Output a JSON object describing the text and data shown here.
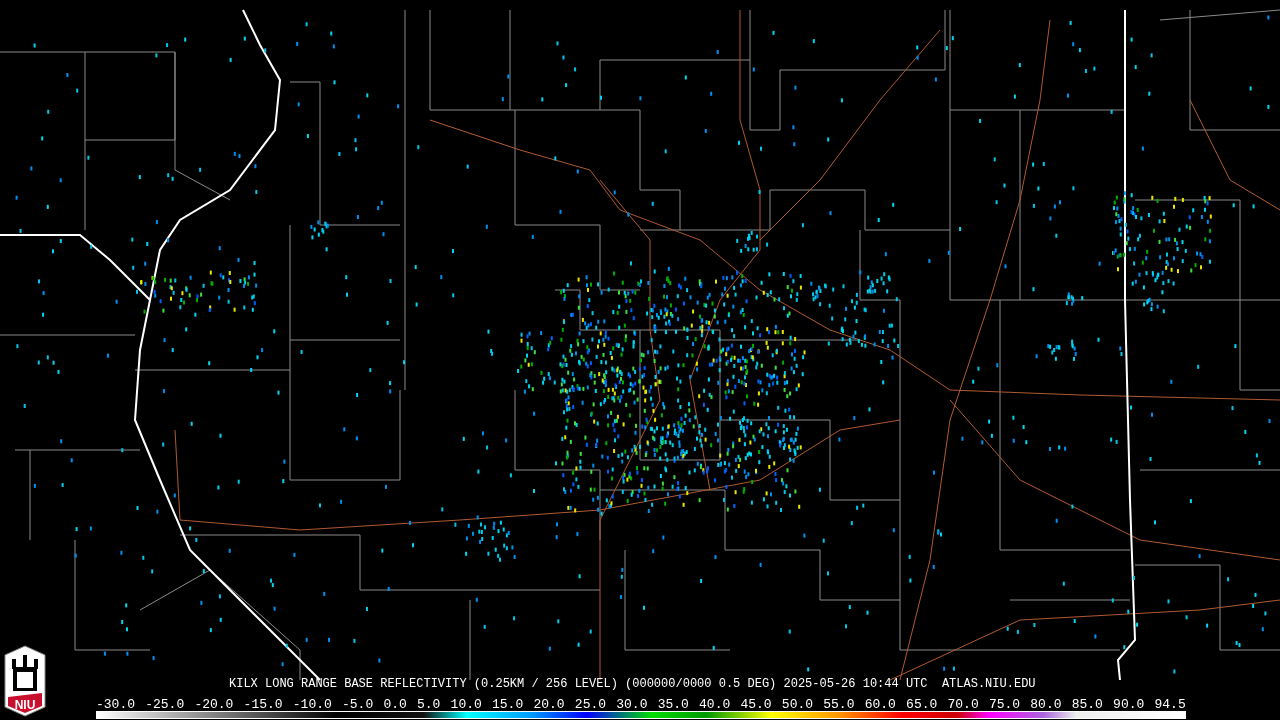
{
  "logo": {
    "text": "NIU"
  },
  "title": "KILX LONG RANGE BASE REFLECTIVITY (0.25KM / 256 LEVEL) (000000/0000 0.5 DEG) 2025-05-26 10:44 UTC  ATLAS.NIU.EDU",
  "legend": {
    "labels": [
      "-30.0",
      "-25.0",
      "-20.0",
      "-15.0",
      "-10.0",
      "-5.0",
      "0.0",
      "5.0",
      "10.0",
      "15.0",
      "20.0",
      "25.0",
      "30.0",
      "35.0",
      "40.0",
      "45.0",
      "50.0",
      "55.0",
      "60.0",
      "65.0",
      "70.0",
      "75.0",
      "80.0",
      "85.0",
      "90.0",
      "94.5"
    ]
  }
}
